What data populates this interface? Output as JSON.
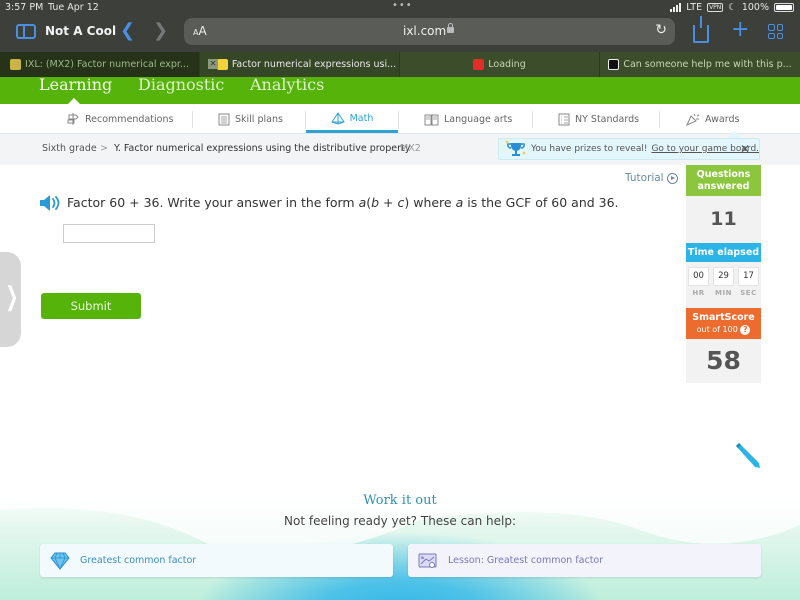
{
  "status_bar": {
    "time": "3:57 PM",
    "date": "Tue Apr 12",
    "network": "LTE",
    "vpn": "VPN",
    "battery": "100%"
  },
  "browser": {
    "tab_group": "Not A Cool",
    "text_size_label_small": "A",
    "text_size_label_large": "A",
    "url": "ixl.com",
    "tabs": [
      {
        "title": "IXL: (MX2) Factor numerical expr...",
        "favicon": "ixl-green-icon",
        "state": "active"
      },
      {
        "title": "Factor numerical expressions usi...",
        "favicon": "ixl-logo-icon",
        "state": "current"
      },
      {
        "title": "Loading",
        "favicon": "youtube-icon",
        "state": "normal"
      },
      {
        "title": "Can someone help me with this p...",
        "favicon": "brainly-icon",
        "state": "normal"
      }
    ]
  },
  "top_nav": {
    "items": [
      {
        "label": "Learning",
        "selected": true
      },
      {
        "label": "Diagnostic",
        "selected": false
      },
      {
        "label": "Analytics",
        "selected": false
      }
    ]
  },
  "sub_nav": {
    "items": [
      {
        "label": "Recommendations",
        "icon": "signpost-icon",
        "selected": false
      },
      {
        "label": "Skill plans",
        "icon": "clipboard-icon",
        "selected": false
      },
      {
        "label": "Math",
        "icon": "pyramid-icon",
        "selected": true
      },
      {
        "label": "Language arts",
        "icon": "book-icon",
        "selected": false
      },
      {
        "label": "NY Standards",
        "icon": "checklist-icon",
        "selected": false
      },
      {
        "label": "Awards",
        "icon": "party-popper-icon",
        "selected": false
      }
    ]
  },
  "breadcrumb": {
    "grade": "Sixth grade",
    "separator": ">",
    "skill": "Y. Factor numerical expressions using the distributive property",
    "code": "MX2"
  },
  "prize_banner": {
    "text": "You have prizes to reveal!",
    "link": "Go to your game board.",
    "close": "✕"
  },
  "question": {
    "tutorial_label": "Tutorial",
    "parts": {
      "p1": "Factor 60 + 36. Write your answer in the form ",
      "a1": "a",
      "p2": "(",
      "b": "b",
      "p3": " + ",
      "c": "c",
      "p4": ") where ",
      "a2": "a",
      "p5": " is the GCF of 60 and 36."
    },
    "answer_value": "",
    "submit_label": "Submit"
  },
  "stats": {
    "questions_answered_label": "Questions answered",
    "questions_answered_value": "11",
    "time_elapsed_label": "Time elapsed",
    "time": {
      "hr": "00",
      "min": "29",
      "sec": "17"
    },
    "time_units": {
      "hr": "HR",
      "min": "MIN",
      "sec": "SEC"
    },
    "smartscore_label": "SmartScore",
    "smartscore_sub": "out of 100",
    "smartscore_help": "?",
    "smartscore_value": "58"
  },
  "help_section": {
    "title": "Work it out",
    "subtitle": "Not feeling ready yet? These can help:",
    "items": [
      {
        "label": "Greatest common factor",
        "icon": "gem-icon"
      },
      {
        "label": "Lesson: Greatest common factor",
        "icon": "lesson-icon"
      }
    ]
  },
  "colors": {
    "ixl_green": "#56b30a",
    "accent_blue": "#2fa3d6",
    "questions_green": "#8cc63f",
    "time_blue": "#2db4e6",
    "smartscore_orange": "#ec6b2e"
  }
}
